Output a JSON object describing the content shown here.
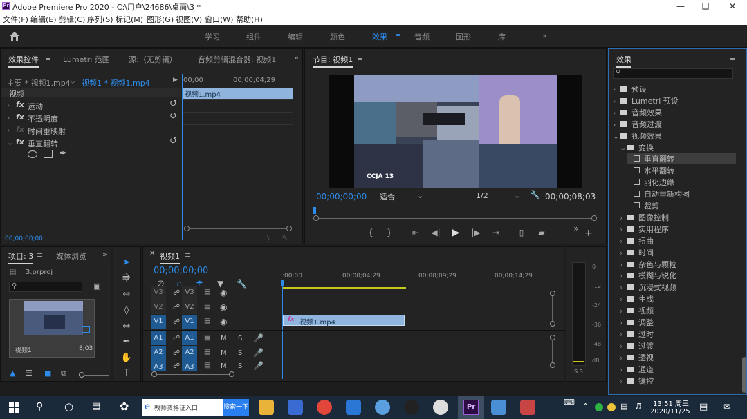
{
  "app": {
    "title": "Adobe Premiere Pro 2020 - C:\\用户\\24686\\桌面\\3 *",
    "icon_text": "Pr"
  },
  "menu": [
    "文件(F)",
    "编辑(E)",
    "剪辑(C)",
    "序列(S)",
    "标记(M)",
    "图形(G)",
    "视图(V)",
    "窗口(W)",
    "帮助(H)"
  ],
  "workspaces": [
    "学习",
    "组件",
    "编辑",
    "颜色",
    "效果",
    "音频",
    "图形",
    "库"
  ],
  "workspace_active": "效果",
  "effect_controls": {
    "tabs": [
      "效果控件",
      "Lumetri 范围",
      "源:（无剪辑）",
      "音频剪辑混合器: 视频1"
    ],
    "master": "主要 * 视频1.mp4",
    "clip": "视频1 * 视频1.mp4",
    "time_start": "00;00",
    "time_end": "00;00;04;29",
    "section": "视频",
    "effects": [
      "运动",
      "不透明度",
      "时间重映射",
      "垂直翻转"
    ],
    "clip_label": "视频1.mp4",
    "timecode": "00;00;00;00"
  },
  "program": {
    "title": "节目: 视频1",
    "timecode": "00;00;00;00",
    "fit": "适合",
    "res": "1/2",
    "duration": "00;00;08;03",
    "video_text": "CCJA 13"
  },
  "project": {
    "tabs": [
      "项目: 3",
      "媒体浏览"
    ],
    "file": "3.prproj",
    "clip_name": "视频1",
    "clip_dur": "8;03"
  },
  "timeline": {
    "title": "视频1",
    "timecode": "00;00;00;00",
    "ticks": [
      ":00;00",
      "00;00;04;29",
      "00;00;09;29",
      "00;00;14;29"
    ],
    "video_tracks": [
      "V3",
      "V2",
      "V1"
    ],
    "audio_tracks": [
      "A1",
      "A2",
      "A3"
    ],
    "clip": "视频1.mp4",
    "fx_label": "fx",
    "mute": "M",
    "solo": "S"
  },
  "meter": {
    "labels": [
      "0",
      "-12",
      "-24",
      "-36",
      "-48",
      "dB"
    ],
    "bottom": "S S"
  },
  "effects_panel": {
    "title": "效果",
    "tree": [
      {
        "label": "预设",
        "level": 0,
        "type": "folder-star"
      },
      {
        "label": "Lumetri 预设",
        "level": 0,
        "type": "folder-star"
      },
      {
        "label": "音频效果",
        "level": 0,
        "type": "folder"
      },
      {
        "label": "音频过渡",
        "level": 0,
        "type": "folder"
      },
      {
        "label": "视频效果",
        "level": 0,
        "type": "folder",
        "open": true
      },
      {
        "label": "变换",
        "level": 1,
        "type": "folder",
        "open": true
      },
      {
        "label": "垂直翻转",
        "level": 2,
        "type": "item",
        "selected": true
      },
      {
        "label": "水平翻转",
        "level": 2,
        "type": "item"
      },
      {
        "label": "羽化边缘",
        "level": 2,
        "type": "item"
      },
      {
        "label": "自动重新构图",
        "level": 2,
        "type": "item"
      },
      {
        "label": "裁剪",
        "level": 2,
        "type": "item"
      },
      {
        "label": "图像控制",
        "level": 1,
        "type": "folder"
      },
      {
        "label": "实用程序",
        "level": 1,
        "type": "folder"
      },
      {
        "label": "扭曲",
        "level": 1,
        "type": "folder"
      },
      {
        "label": "时间",
        "level": 1,
        "type": "folder"
      },
      {
        "label": "杂色与颗粒",
        "level": 1,
        "type": "folder"
      },
      {
        "label": "模糊与锐化",
        "level": 1,
        "type": "folder"
      },
      {
        "label": "沉浸式视频",
        "level": 1,
        "type": "folder"
      },
      {
        "label": "生成",
        "level": 1,
        "type": "folder"
      },
      {
        "label": "视频",
        "level": 1,
        "type": "folder"
      },
      {
        "label": "调整",
        "level": 1,
        "type": "folder"
      },
      {
        "label": "过时",
        "level": 1,
        "type": "folder"
      },
      {
        "label": "过渡",
        "level": 1,
        "type": "folder"
      },
      {
        "label": "透视",
        "level": 1,
        "type": "folder"
      },
      {
        "label": "通道",
        "level": 1,
        "type": "folder"
      },
      {
        "label": "键控",
        "level": 1,
        "type": "folder"
      }
    ]
  },
  "taskbar": {
    "search_text": "教师资格证入口",
    "search_button": "搜索一下",
    "time": "13:51 周三",
    "date": "2020/11/25"
  },
  "colors": {
    "accent": "#2d8ceb",
    "clip": "#8fb5de",
    "track_header": "#1f5a92",
    "selected": "#3d3d3d"
  }
}
